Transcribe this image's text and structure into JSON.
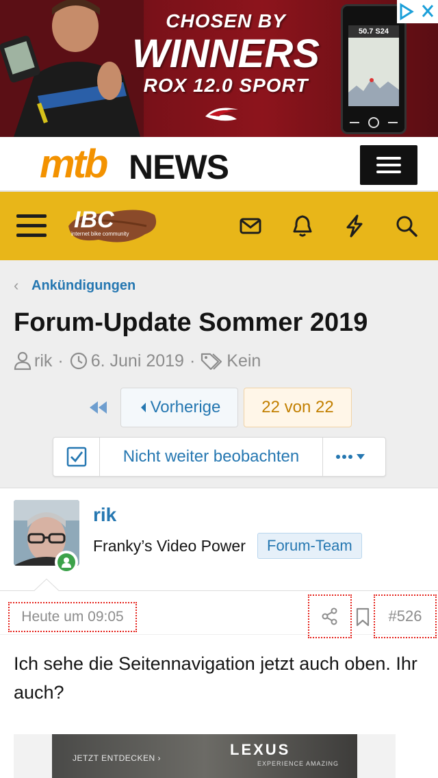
{
  "ad_top": {
    "line1": "CHOSEN BY",
    "line2": "WINNERS",
    "line3": "ROX 12.0 SPORT",
    "device_screen": "50.7   S24"
  },
  "site_header": {
    "logo_mtb": "mtb",
    "logo_news": "NEWS"
  },
  "ibc_bar": {
    "logo_text": "IBC",
    "logo_subtitle": "internet bike community",
    "icons": [
      "inbox-icon",
      "bell-icon",
      "lightning-icon",
      "search-icon"
    ]
  },
  "breadcrumb": {
    "label": "Ankündigungen"
  },
  "thread": {
    "title": "Forum-Update Sommer 2019",
    "author": "rik",
    "date": "6. Juni 2019",
    "tags": "Kein"
  },
  "pager": {
    "prev_label": "Vorherige",
    "count_label": "22 von 22"
  },
  "watch": {
    "label": "Nicht weiter beobachten"
  },
  "post": {
    "username": "rik",
    "user_title": "Franky’s Video Power",
    "user_banner": "Forum-Team",
    "time": "Heute um 09:05",
    "number": "#526",
    "body": "Ich sehe die Seitennavigation jetzt auch oben. Ihr auch?"
  },
  "ad_bottom": {
    "cta": "JETZT ENTDECKEN ›",
    "brand": "LEXUS",
    "tagline": "EXPERIENCE AMAZING"
  },
  "colors": {
    "accent_link": "#2577b1",
    "ibc_yellow": "#e8b619",
    "mtb_orange": "#f39200",
    "online_green": "#3ca24a",
    "highlight_red": "#e52019"
  }
}
